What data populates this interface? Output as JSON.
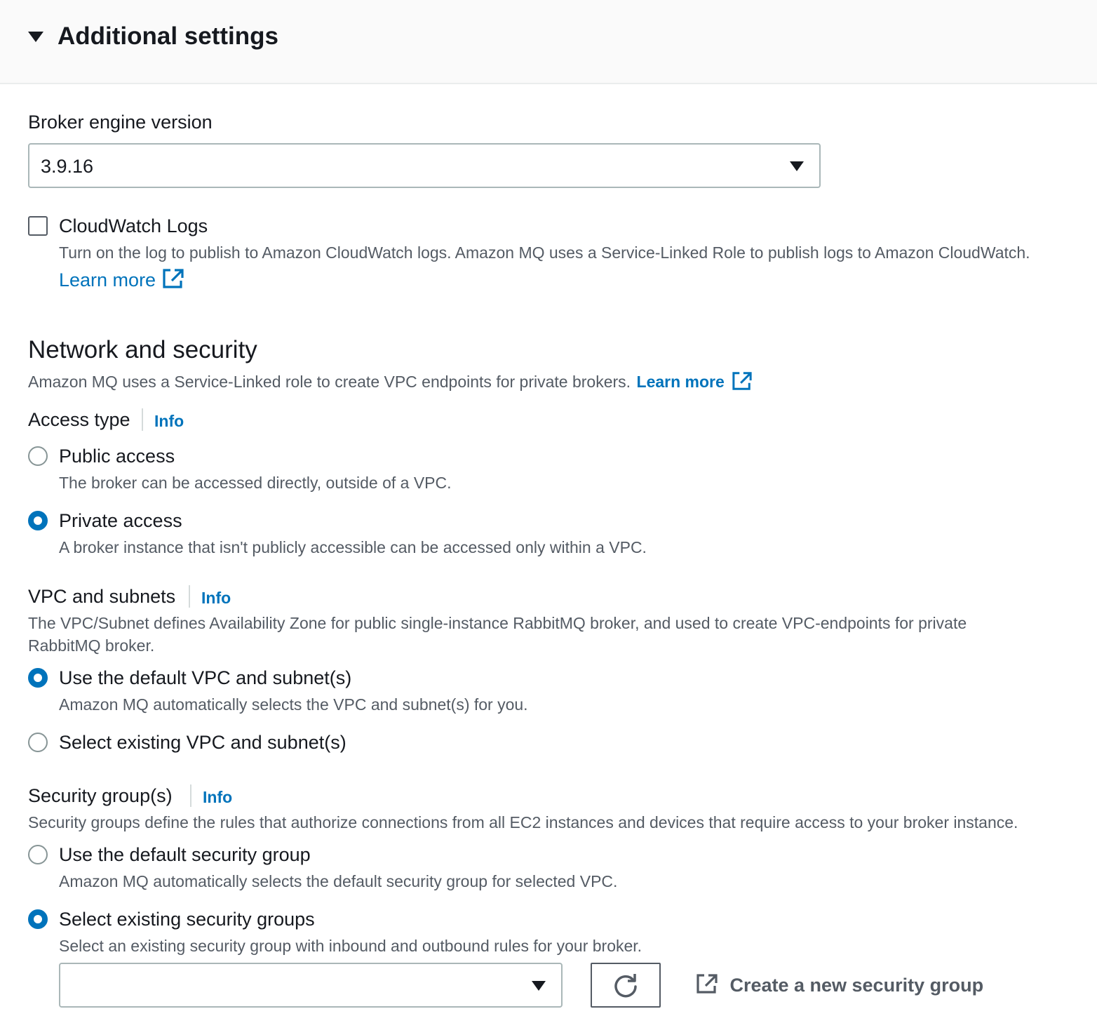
{
  "header": {
    "title": "Additional settings"
  },
  "engine": {
    "label": "Broker engine version",
    "value": "3.9.16"
  },
  "cloudwatch": {
    "label": "CloudWatch Logs",
    "checked": false,
    "description": "Turn on the log to publish to Amazon CloudWatch logs. Amazon MQ uses a Service-Linked Role to publish logs to Amazon CloudWatch.",
    "learn_more": "Learn more"
  },
  "network": {
    "title": "Network and security",
    "description": "Amazon MQ uses a Service-Linked role to create VPC endpoints for private brokers.",
    "learn_more": "Learn more"
  },
  "access_type": {
    "label": "Access type",
    "info": "Info",
    "options": [
      {
        "label": "Public access",
        "description": "The broker can be accessed directly, outside of a VPC.",
        "selected": false
      },
      {
        "label": "Private access",
        "description": "A broker instance that isn't publicly accessible can be accessed only within a VPC.",
        "selected": true
      }
    ]
  },
  "vpc": {
    "label": "VPC and subnets",
    "info": "Info",
    "description_line1": "The VPC/Subnet defines Availability Zone for public single-instance RabbitMQ broker, and used to create VPC-endpoints for private",
    "description_line2": "RabbitMQ broker.",
    "options": [
      {
        "label": "Use the default VPC and subnet(s)",
        "description": "Amazon MQ automatically selects the VPC and subnet(s) for you.",
        "selected": true
      },
      {
        "label": "Select existing VPC and subnet(s)",
        "selected": false
      }
    ]
  },
  "security_groups": {
    "label": "Security group(s)",
    "info": "Info",
    "description": "Security groups define the rules that authorize connections from all EC2 instances and devices that require access to your broker instance.",
    "options": [
      {
        "label": "Use the default security group",
        "description": "Amazon MQ automatically selects the default security group for selected VPC.",
        "selected": false
      },
      {
        "label": "Select existing security groups",
        "description": "Select an existing security group with inbound and outbound rules for your broker.",
        "selected": true
      }
    ],
    "select_value": "",
    "create_label": "Create a new security group"
  },
  "icons": {
    "external_link": "external-link-icon",
    "refresh": "refresh-icon",
    "caret": "caret-down-icon"
  },
  "colors": {
    "link": "#0073bb",
    "radio_selected": "#0073bb",
    "text": "#16191f",
    "muted": "#545b64"
  }
}
